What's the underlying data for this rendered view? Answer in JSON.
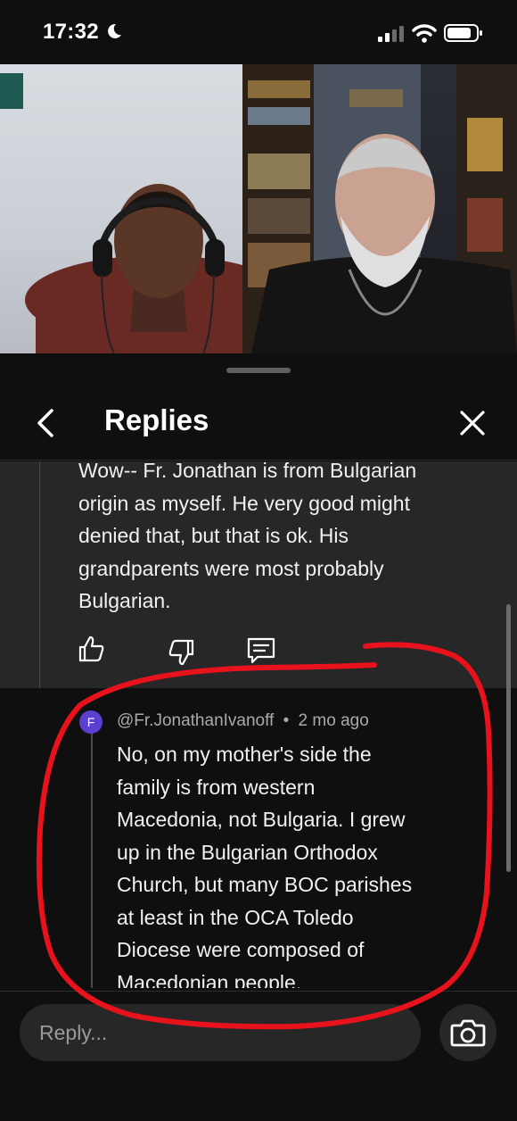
{
  "status_bar": {
    "time": "17:32",
    "icons": [
      "moon-icon",
      "signal-icon",
      "wifi-icon",
      "battery-icon"
    ]
  },
  "video": {
    "description_icons": [
      "video-frame-left",
      "video-frame-right"
    ]
  },
  "header": {
    "title": "Replies",
    "back_icon": "chevron-left-icon",
    "close_icon": "close-icon"
  },
  "parent_comment": {
    "lines": [
      "Wow-- Fr. Jonathan is from Bulgarian",
      "origin as myself. He very good might",
      "denied that, but that is ok. His",
      "grandparents were most probably",
      "Bulgarian."
    ],
    "actions": [
      "thumbs-up-icon",
      "thumbs-down-icon",
      "reply-icon"
    ]
  },
  "reply": {
    "avatar_letter": "F",
    "author": "@Fr.JonathanIvanoff",
    "separator": "•",
    "time": "2 mo ago",
    "lines": [
      "No, on my mother's side the",
      "family is from western",
      "Macedonia, not Bulgaria. I grew",
      "up in the Bulgarian Orthodox",
      "Church, but many BOC parishes",
      "at least in the OCA Toledo",
      "Diocese were composed of",
      "Macedonian people."
    ]
  },
  "composer": {
    "placeholder": "Reply...",
    "camera_icon": "camera-icon"
  },
  "colors": {
    "background": "#0f0f0f",
    "card": "#272727",
    "text": "#f1f1f1",
    "meta": "#aaaaaa",
    "avatar": "#5b3fd1",
    "annotation": "#e8121c"
  }
}
